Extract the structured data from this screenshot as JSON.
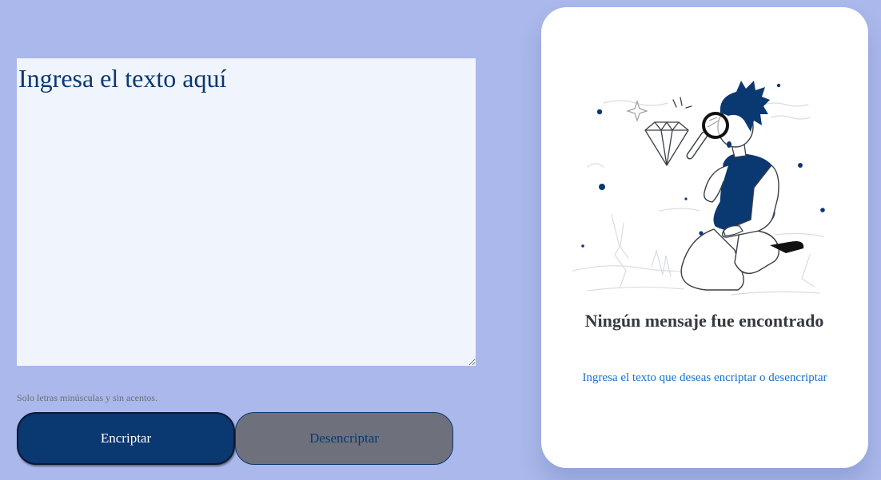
{
  "input": {
    "placeholder": "Ingresa el texto aquí",
    "value": ""
  },
  "hint": {
    "icon": "info-icon",
    "text": "Solo letras minúsculas y sin acentos."
  },
  "buttons": {
    "encrypt_label": "Encriptar",
    "decrypt_label": "Desencriptar"
  },
  "output_panel": {
    "illustration": "person-with-magnifier-illustration",
    "title": "Ningún mensaje fue encontrado",
    "text": "Ingresa el texto que deseas encriptar o desencriptar"
  },
  "colors": {
    "background": "#aab8eb",
    "textarea_bg": "#f0f4fd",
    "primary": "#0a3871",
    "secondary_button": "#6e717c",
    "card_bg": "#ffffff",
    "link_text": "#1a6fc9"
  }
}
